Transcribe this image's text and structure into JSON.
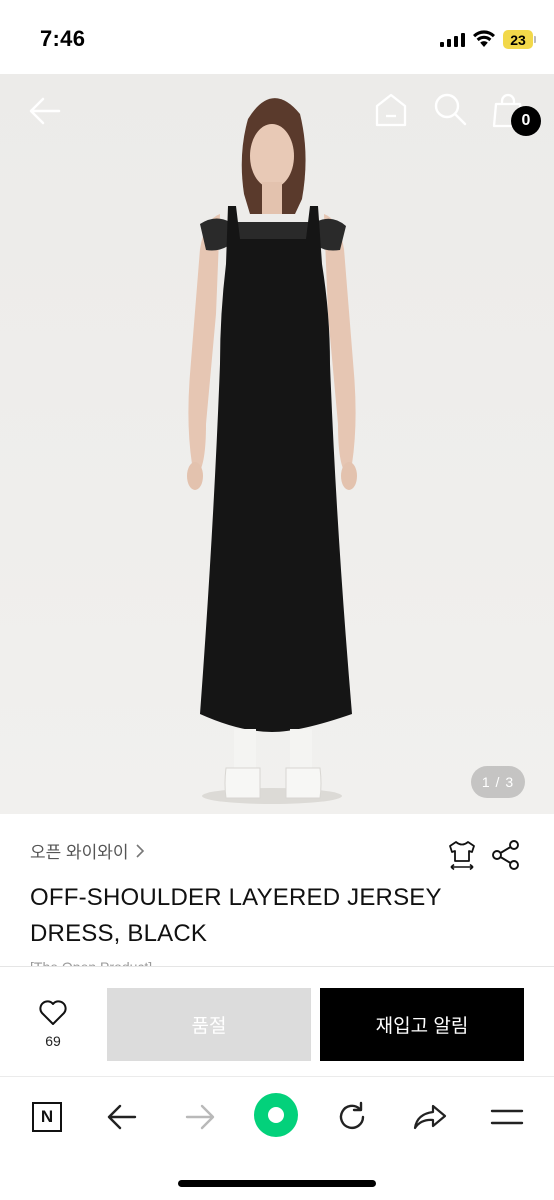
{
  "status_bar": {
    "time": "7:46",
    "battery": "23",
    "battery_color": "#f2d84a"
  },
  "hero": {
    "background": "#efefed",
    "image_index": "1 / 3",
    "cart_count": "0",
    "icons": [
      "back-arrow-icon",
      "home-icon",
      "search-icon",
      "bag-icon"
    ]
  },
  "product": {
    "brand": "오픈 와이와이",
    "title": "OFF-SHOULDER LAYERED JERSEY DRESS, BLACK",
    "subtitle_fragment": "[The Open Product]",
    "icons": [
      "size-guide-icon",
      "share-icon"
    ]
  },
  "actions": {
    "like_count": "69",
    "sold_out_label": "품절",
    "restock_label": "재입고 알림"
  },
  "browser_toolbar": {
    "n_label": "N",
    "accent_color": "#03d17b",
    "icons": [
      "naver-n-icon",
      "back-icon",
      "forward-icon",
      "green-home-icon",
      "reload-icon",
      "share-icon",
      "menu-icon"
    ]
  }
}
